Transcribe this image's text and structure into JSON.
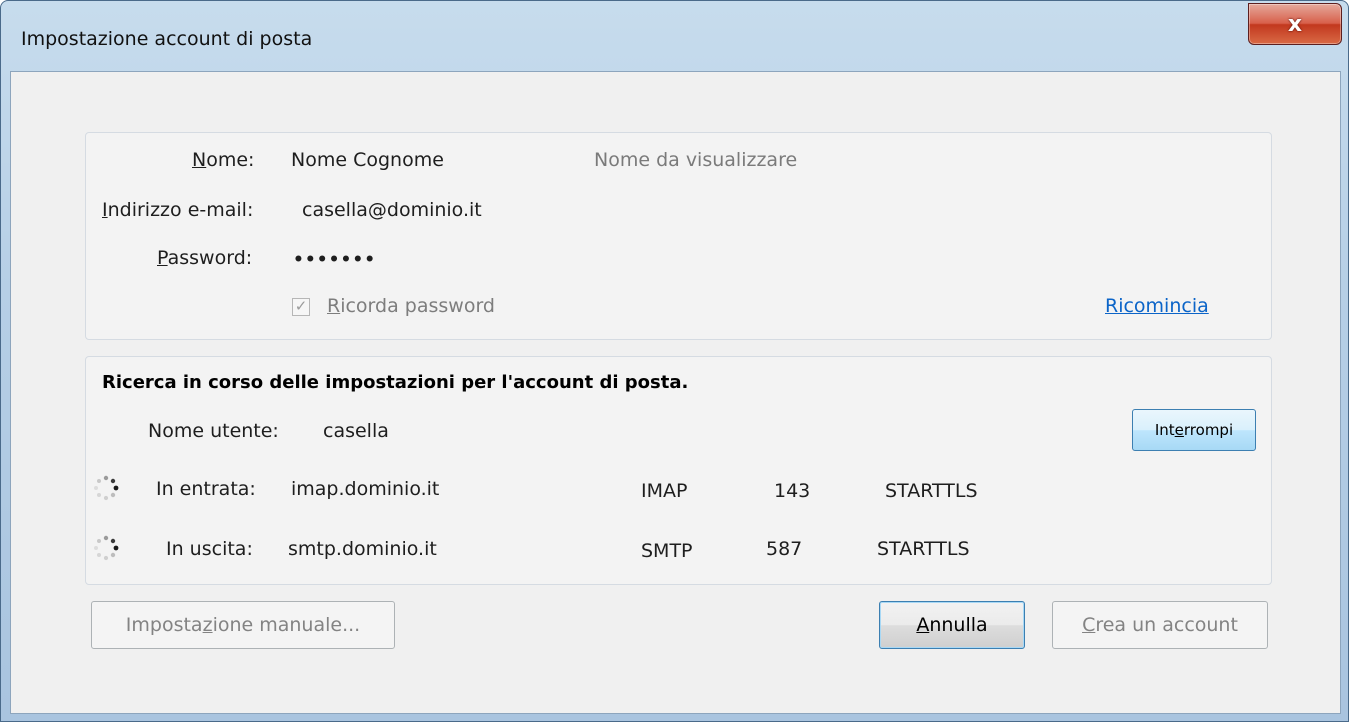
{
  "window": {
    "title": "Impostazione account di posta",
    "close_label": "x"
  },
  "account": {
    "name_label": "Nome:",
    "name_value": "Nome Cognome",
    "name_hint": "Nome da visualizzare",
    "email_label": "Indirizzo e-mail:",
    "email_value": "casella@dominio.it",
    "password_label": "Password:",
    "password_value": "•••••••",
    "remember_label": "Ricorda password",
    "remember_checked": true,
    "restart_link": "Ricomincia"
  },
  "search": {
    "status_text": "Ricerca in corso delle impostazioni per l'account di posta.",
    "username_label": "Nome utente:",
    "username_value": "casella",
    "stop_button": "Interrompi",
    "incoming": {
      "label": "In entrata:",
      "host": "imap.dominio.it",
      "protocol": "IMAP",
      "port": "143",
      "security": "STARTTLS"
    },
    "outgoing": {
      "label": "In uscita:",
      "host": "smtp.dominio.it",
      "protocol": "SMTP",
      "port": "587",
      "security": "STARTTLS"
    }
  },
  "footer": {
    "manual_button": "Impostazione manuale...",
    "cancel_button": "Annulla",
    "create_button": "Crea un account"
  },
  "colors": {
    "link": "#0b64c8",
    "close_button": "#c2381e",
    "dialog_background": "#f0f0f0"
  }
}
